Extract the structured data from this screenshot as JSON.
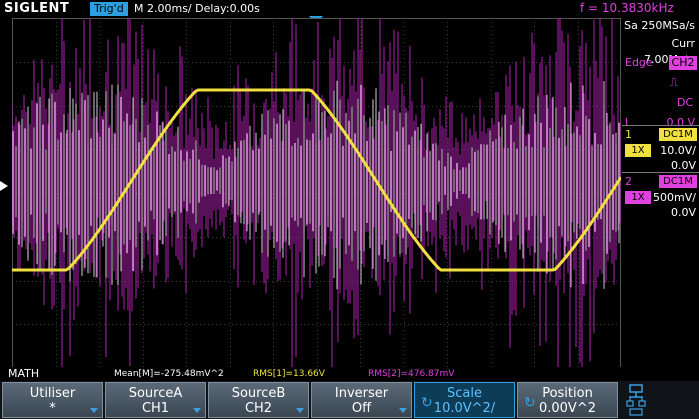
{
  "header": {
    "logo": "SIGLENT",
    "trig_status": "Trig'd",
    "timebase": "M 2.00ms/ Delay:0.00s",
    "frequency": "f = 10.3830kHz"
  },
  "acquisition": {
    "sample_rate": "Sa 250MSa/s",
    "memory": "Curr 7.00Mpts"
  },
  "trigger": {
    "type_label": "Edge",
    "source": "CH2",
    "coupling": "DC",
    "level_label": "L",
    "level": "0.0 V"
  },
  "channels": [
    {
      "number": "1",
      "coupling": "DC1M",
      "probe": "1X",
      "scale": "10.0V/",
      "offset": "0.0V",
      "color": "#f0e040"
    },
    {
      "number": "2",
      "coupling": "DC1M",
      "probe": "1X",
      "scale": "500mV/",
      "offset": "0.0V",
      "color": "#e040e0"
    }
  ],
  "math": {
    "label": "MATH",
    "mean": "Mean[M]=-275.48mV^2",
    "rms1": "RMS[1]=13.66V",
    "rms2": "RMS[2]=476.87mV"
  },
  "menu": [
    {
      "title": "Utiliser",
      "value": "*"
    },
    {
      "title": "SourceA",
      "value": "CH1"
    },
    {
      "title": "SourceB",
      "value": "CH2"
    },
    {
      "title": "Inverser",
      "value": "Off"
    },
    {
      "title": "Scale",
      "value": "10.0V^2/"
    },
    {
      "title": "Position",
      "value": "0.00V^2"
    }
  ],
  "colors": {
    "ch1": "#f0e040",
    "ch2": "#e040e0",
    "math": "#ffffff",
    "accent": "#2aa0e0"
  }
}
